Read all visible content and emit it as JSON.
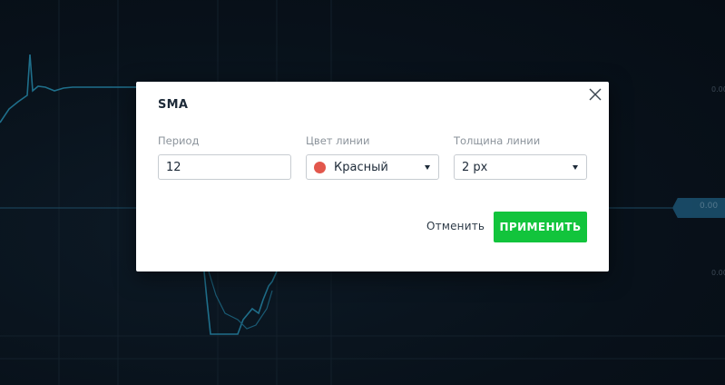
{
  "dialog": {
    "title": "SMA",
    "period": {
      "label": "Период",
      "value": "12"
    },
    "line_color": {
      "label": "Цвет линии",
      "value": "Красный",
      "swatch_color": "#e2574c"
    },
    "line_width": {
      "label": "Толщина линии",
      "value": "2 px"
    },
    "cancel_label": "Отменить",
    "apply_label": "ПРИМЕНИТЬ",
    "close_icon": "close-icon"
  },
  "background": {
    "price_tag_text": "0.00",
    "axis_labels": [
      "0.00",
      "0.00"
    ],
    "colors": {
      "backdrop": "#0a121c",
      "chart_line": "#1f6f8b",
      "accent_green": "#12c43c"
    }
  }
}
